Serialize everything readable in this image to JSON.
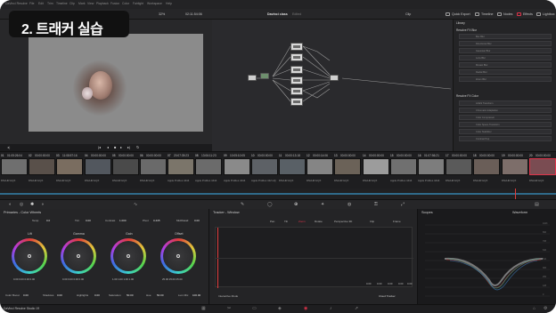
{
  "menu": {
    "items": [
      "DaVinci Resolve",
      "File",
      "Edit",
      "Trim",
      "Timeline",
      "Clip",
      "Mark",
      "View",
      "Playback",
      "Fusion",
      "Color",
      "Fairlight",
      "Workspace",
      "Help"
    ]
  },
  "toolbar": {
    "zoom": "32%",
    "timecode_left": "02:11:54:06",
    "project_title": "Davinci class",
    "project_status": "Edited",
    "clip_label": "Clip",
    "quick_export": "Quick Export",
    "timeline_tab": "Timeline",
    "nodes_tab": "Nodes",
    "effects_tab": "Effects",
    "lightbox_tab": "Lightbox"
  },
  "overlay_title": "2. 트래커 실습",
  "viewer": {
    "timecode": "01:05:26:04"
  },
  "library": {
    "title": "Library",
    "section1": "Resolve FX Blur",
    "blur_items": [
      "Box Blur",
      "Directional Blur",
      "Gaussian Blur",
      "Lens Blur",
      "Mosaic Blur",
      "Radial Blur",
      "Zoom Blur"
    ],
    "section2": "Resolve FX Color",
    "color_items": [
      "ACES Transform",
      "Chromatic Adaptation",
      "Color Compressor",
      "Color Space Transform",
      "Color Stabilizer",
      "Contrast Pop"
    ]
  },
  "clips": [
    {
      "num": "01",
      "tc": "01:05:26:04",
      "label": "DNxHR HQX"
    },
    {
      "num": "02",
      "tc": "00:00:00:00",
      "label": "DNxHR HQX"
    },
    {
      "num": "03",
      "tc": "11:08:57:16",
      "label": "DNxHR HQX"
    },
    {
      "num": "04",
      "tc": "00:00:00:00",
      "label": "DNxHR HQX"
    },
    {
      "num": "05",
      "tc": "00:00:00:00",
      "label": "DNxHR HQX"
    },
    {
      "num": "06",
      "tc": "00:00:00:00",
      "label": "DNxHR HQX"
    },
    {
      "num": "07",
      "tc": "20:07:39:23",
      "label": "Apple ProRes 4444"
    },
    {
      "num": "08",
      "tc": "13:06:11:23",
      "label": "Apple ProRes 4444"
    },
    {
      "num": "09",
      "tc": "10:05:10:05",
      "label": "Apple ProRes 4444"
    },
    {
      "num": "10",
      "tc": "00:00:00:00",
      "label": "Apple ProRes 422 HQ"
    },
    {
      "num": "11",
      "tc": "00:00:13:18",
      "label": "DNxHR HQX"
    },
    {
      "num": "12",
      "tc": "00:00:14:06",
      "label": "DNxHR HQX"
    },
    {
      "num": "13",
      "tc": "00:00:00:00",
      "label": "DNxHR HQX"
    },
    {
      "num": "14",
      "tc": "00:00:00:00",
      "label": "DNxHR HQX"
    },
    {
      "num": "15",
      "tc": "00:00:00:00",
      "label": "Apple ProRes 4444"
    },
    {
      "num": "16",
      "tc": "01:07:56:21",
      "label": "Apple ProRes 4444"
    },
    {
      "num": "17",
      "tc": "00:00:00:00",
      "label": "DNxHR HQX"
    },
    {
      "num": "18",
      "tc": "00:00:00:00",
      "label": "DNxHR HQX"
    },
    {
      "num": "19",
      "tc": "00:00:00:00",
      "label": "DNxHR HQX"
    },
    {
      "num": "20",
      "tc": "00:00:00:00",
      "label": "DNxHR HQX"
    }
  ],
  "primaries": {
    "title": "Primaries - Color Wheels",
    "temp_label": "Temp",
    "temp_value": "0.0",
    "tint_label": "Tint",
    "tint_value": "0.00",
    "contrast_label": "Contrast",
    "contrast_value": "1.000",
    "pivot_label": "Pivot",
    "pivot_value": "0.435",
    "middetail_label": "Mid/Detail",
    "middetail_value": "0.00",
    "wheels": [
      {
        "name": "Lift",
        "values": "0.00  0.00  0.00  0.00"
      },
      {
        "name": "Gamma",
        "values": "0.00  0.00  0.00  0.00"
      },
      {
        "name": "Gain",
        "values": "1.00  1.00  1.00  1.00"
      },
      {
        "name": "Offset",
        "values": "25.00  25.00  25.00"
      }
    ],
    "colorboost_label": "Color Boost",
    "colorboost_value": "0.00",
    "shadows_label": "Shadows",
    "shadows_value": "0.00",
    "highlights_label": "Highlights",
    "highlights_value": "0.00",
    "saturation_label": "Saturation",
    "saturation_value": "50.00",
    "hue_label": "Hue",
    "hue_value": "50.00",
    "lummix_label": "Lum Mix",
    "lummix_value": "100.00"
  },
  "tracker": {
    "title": "Tracker - Window",
    "pan": "Pan",
    "tilt": "Tilt",
    "zoom": "Zoom",
    "rotate": "Rotate",
    "perspective": "Perspective 3D",
    "clip": "Clip",
    "frame": "Frame",
    "values": [
      "0.00",
      "0.00",
      "0.00",
      "0.00",
      "0.00"
    ],
    "mode_label": "Interactive Mode",
    "tracker_select": "Cloud Tracker"
  },
  "scopes": {
    "title": "Scopes",
    "mode": "Waveform",
    "ticks": [
      "1023",
      "896",
      "768",
      "640",
      "512",
      "384",
      "256",
      "128",
      "0"
    ]
  },
  "footer": {
    "app": "DaVinci Resolve Studio 19"
  },
  "colors": {
    "accent_red": "#e0334a",
    "playhead": "#e23b3b",
    "active_tab": "#4a83d6"
  }
}
